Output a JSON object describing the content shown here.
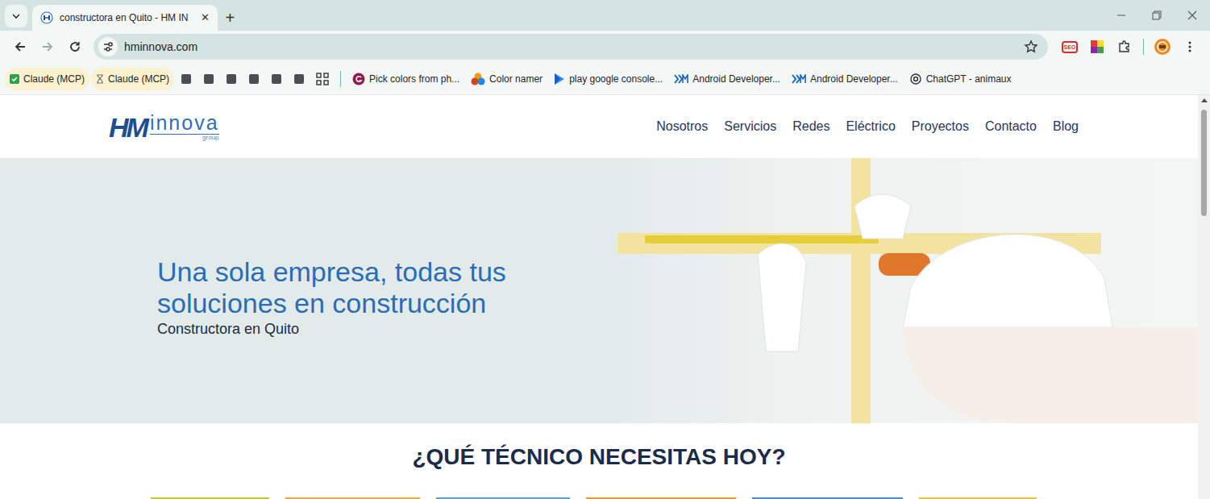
{
  "tabs": [
    {
      "label": "constructora en Quito - HM IN",
      "selected": true,
      "close": "✕"
    }
  ],
  "new_tab": "+",
  "address": {
    "url": "hminnova.com"
  },
  "extensions": {
    "seo": "SEO"
  },
  "bookmarks": [
    {
      "kind": "check",
      "label": "Claude (MCP)"
    },
    {
      "kind": "hourglass",
      "label": "Claude (MCP)"
    },
    {
      "kind": "square",
      "label": ""
    },
    {
      "kind": "square",
      "label": ""
    },
    {
      "kind": "square",
      "label": ""
    },
    {
      "kind": "square",
      "label": ""
    },
    {
      "kind": "square",
      "label": ""
    },
    {
      "kind": "square",
      "label": ""
    },
    {
      "kind": "apps",
      "label": ""
    },
    {
      "kind": "gsite",
      "label": "Pick colors from ph..."
    },
    {
      "kind": "palette",
      "label": "Color namer"
    },
    {
      "kind": "play",
      "label": "play google console..."
    },
    {
      "kind": "xm",
      "label": "Android Developer..."
    },
    {
      "kind": "xm",
      "label": "Android Developer..."
    },
    {
      "kind": "chat",
      "label": "ChatGPT - animaux"
    }
  ],
  "site": {
    "logo": {
      "mark": "HM",
      "name": "innova",
      "tag": "group"
    },
    "nav": [
      {
        "label": "Nosotros"
      },
      {
        "label": "Servicios"
      },
      {
        "label": "Redes"
      },
      {
        "label": "Eléctrico"
      },
      {
        "label": "Proyectos"
      },
      {
        "label": "Contacto"
      },
      {
        "label": "Blog"
      }
    ],
    "hero": {
      "title": "Una sola empresa, todas tus soluciones en construcción",
      "subtitle": "Constructora en Quito"
    },
    "services": {
      "heading": "¿QUÉ TÉCNICO NECESITAS HOY?",
      "cards": [
        {
          "color": "#c3d116"
        },
        {
          "color": "#f2a93b"
        },
        {
          "color": "#5aa0dc"
        },
        {
          "color": "#f39a2c"
        },
        {
          "color": "#3f8ee0"
        },
        {
          "color": "#f0c52a"
        }
      ]
    }
  }
}
